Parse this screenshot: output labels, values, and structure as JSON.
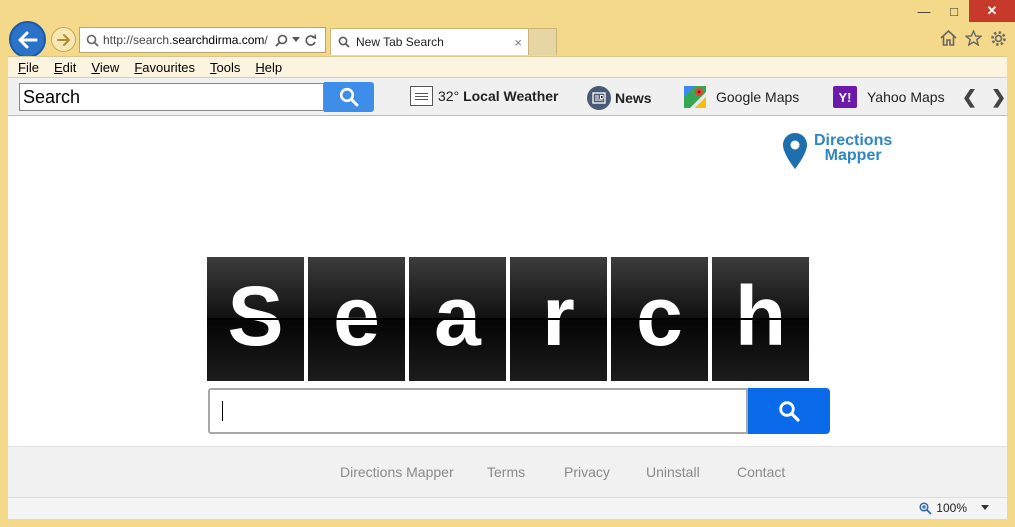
{
  "browser": {
    "address_prefix": "http://search.",
    "address_domain": "searchdirma.com",
    "address_suffix": "/",
    "tab_title": "New Tab Search",
    "tab_close": "×",
    "win_min": "—",
    "win_max": "□",
    "win_close": "✕"
  },
  "menu": {
    "items": [
      {
        "first": "F",
        "rest": "ile"
      },
      {
        "first": "E",
        "rest": "dit"
      },
      {
        "first": "V",
        "rest": "iew"
      },
      {
        "first": "F",
        "rest": "avourites"
      },
      {
        "first": "T",
        "rest": "ools"
      },
      {
        "first": "H",
        "rest": "elp"
      }
    ]
  },
  "toolbar": {
    "search_placeholder": "Search",
    "weather_temp": "32°",
    "weather_label": "Local Weather",
    "news_label": "News",
    "gmaps_label": "Google Maps",
    "ymaps_label": "Yahoo Maps",
    "yahoo_icon_text": "Y!",
    "arrow_left": "❮",
    "arrow_right": "❯"
  },
  "logo": {
    "line1": "Directions",
    "line2": "Mapper"
  },
  "hero": {
    "letters": [
      "S",
      "e",
      "a",
      "r",
      "c",
      "h"
    ]
  },
  "footer": {
    "links": [
      "Directions Mapper",
      "Terms",
      "Privacy",
      "Uninstall",
      "Contact"
    ]
  },
  "status": {
    "zoom": "100%"
  },
  "colors": {
    "accent": "#0a6bea",
    "frame": "#f4d98a",
    "logo": "#2f86c4"
  }
}
